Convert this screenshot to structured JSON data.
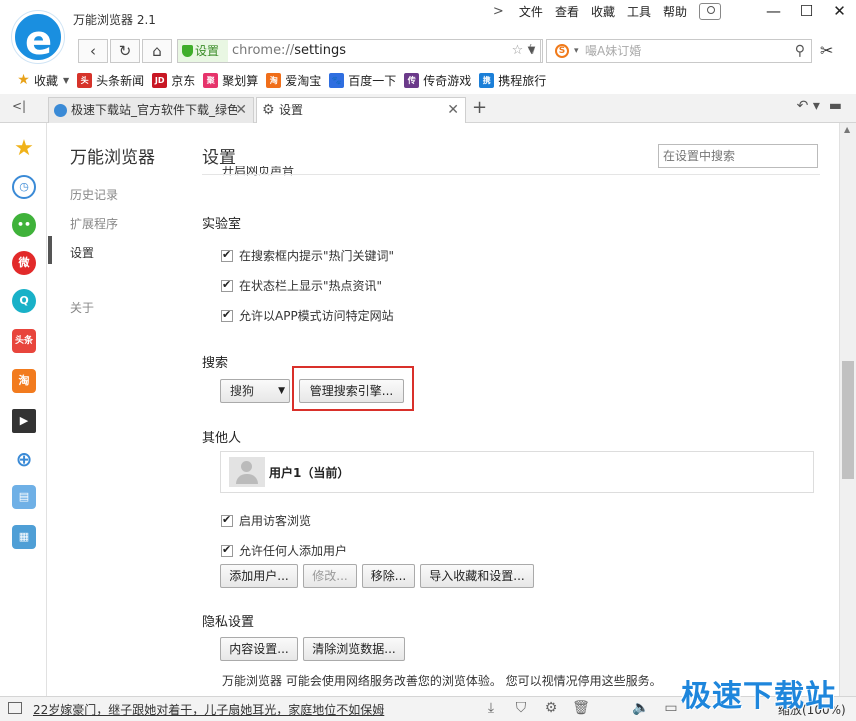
{
  "window": {
    "title": "万能浏览器 2.1",
    "menu": [
      "文件",
      "查看",
      "收藏",
      "工具",
      "帮助"
    ],
    "minimize": "—",
    "maximize": "☐",
    "close": "✕"
  },
  "address": {
    "secure_label": "设置",
    "url_scheme": "chrome://",
    "url_path": "settings",
    "search_placeholder": "嘬A妹订婚"
  },
  "bookmarks": {
    "favorites_label": "收藏",
    "items": [
      {
        "label": "头条新闻",
        "icon_text": "头条",
        "color": "#d6332a"
      },
      {
        "label": "京东",
        "icon_text": "JD",
        "color": "#c81623"
      },
      {
        "label": "聚划算",
        "icon_text": "聚",
        "color": "#e6336b"
      },
      {
        "label": "爱淘宝",
        "icon_text": "淘",
        "color": "#f06e1a"
      },
      {
        "label": "百度一下",
        "icon_text": "🐾",
        "color": "#2f6ee0"
      },
      {
        "label": "传奇游戏",
        "icon_text": "传",
        "color": "#6b3a8a"
      },
      {
        "label": "携程旅行",
        "icon_text": "携",
        "color": "#1b7fd8"
      }
    ]
  },
  "tabs": [
    {
      "label": "极速下载站_官方软件下载_绿色",
      "active": false
    },
    {
      "label": "设置",
      "active": true
    }
  ],
  "settings_nav": {
    "title": "万能浏览器",
    "items": [
      "历史记录",
      "扩展程序",
      "设置",
      "关于"
    ]
  },
  "settings": {
    "title": "设置",
    "search_placeholder": "在设置中搜索",
    "cut_off_item": "开启网页声音",
    "lab": {
      "title": "实验室",
      "options": [
        "在搜索框内提示\"热门关键词\"",
        "在状态栏上显示\"热点资讯\"",
        "允许以APP模式访问特定网站"
      ]
    },
    "search": {
      "title": "搜索",
      "engine": "搜狗",
      "manage_button": "管理搜索引擎..."
    },
    "people": {
      "title": "其他人",
      "user": "用户1（当前）",
      "options": [
        "启用访客浏览",
        "允许任何人添加用户"
      ],
      "buttons": [
        "添加用户...",
        "修改...",
        "移除...",
        "导入收藏和设置..."
      ]
    },
    "privacy": {
      "title": "隐私设置",
      "buttons": [
        "内容设置...",
        "清除浏览数据..."
      ],
      "notice": "万能浏览器 可能会使用网络服务改善您的浏览体验。 您可以视情况停用这些服务。"
    }
  },
  "status": {
    "news": "22岁嫁豪门，继子跟她对着干，儿子扇她耳光，家庭地位不如保姆",
    "zoom": "缩放(100%)"
  },
  "watermark": "极速下载站"
}
